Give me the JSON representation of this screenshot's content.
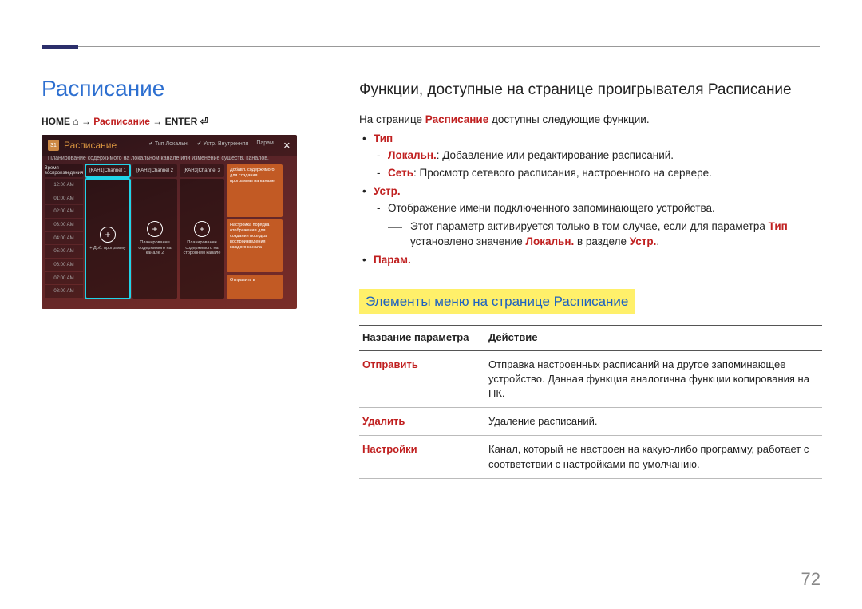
{
  "page_number": "72",
  "left": {
    "title": "Расписание",
    "breadcrumb": {
      "home": "HOME",
      "arrow1": " → ",
      "schedule": "Расписание",
      "arrow2": " → ",
      "enter": "ENTER"
    }
  },
  "screenshot": {
    "cal_icon_text": "31",
    "title": "Расписание",
    "header_right": {
      "type_label": "✔ Тип",
      "type_value": "Локальн.",
      "device_label": "✔ Устр.",
      "device_value": "Внутренняя",
      "options": "Парам.",
      "close": "✕"
    },
    "subtitle": "Планирование содержимого на локальном канале или изменение существ. каналов.",
    "time_header": "Время воспроизведения",
    "times": [
      "12:00 AM",
      "01:00 AM",
      "02:00 AM",
      "03:00 AM",
      "04:00 AM",
      "05:00 AM",
      "06:00 AM",
      "07:00 AM",
      "08:00 AM"
    ],
    "channels": [
      {
        "header": "[КАН1]Channel 1",
        "caption": "+ Доб. программу"
      },
      {
        "header": "[КАН2]Channel 2",
        "caption": "Планирование содержимого на канале 2"
      },
      {
        "header": "[КАН3]Channel 3",
        "caption": "Планирование содержимого на стороннем канале"
      }
    ],
    "side": [
      "Добавл. содержимого для создания программы на канале",
      "Настройка порядка отображения для создания порядка воспроизведения каждого канала",
      "Отправить в"
    ]
  },
  "right": {
    "heading": "Функции, доступные на странице проигрывателя Расписание",
    "intro_a": "На странице ",
    "intro_b": "Расписание",
    "intro_c": " доступны следующие функции.",
    "bullets": {
      "type": "Тип",
      "type_local_name": "Локальн.",
      "type_local_txt": ": Добавление или редактирование расписаний.",
      "type_net_name": "Сеть",
      "type_net_txt": ": Просмотр сетевого расписания, настроенного на сервере.",
      "device": "Устр.",
      "device_txt": "Отображение имени подключенного запоминающего устройства.",
      "device_note_a": "Этот параметр активируется только в том случае, если для параметра ",
      "device_note_b": "Тип",
      "device_note_c": " установлено значение ",
      "device_note_d": "Локальн.",
      "device_note_e": " в разделе ",
      "device_note_f": "Устр.",
      "options": "Парам."
    },
    "section_heading": "Элементы меню на странице Расписание",
    "table": {
      "col1": "Название параметра",
      "col2": "Действие",
      "rows": [
        {
          "name": "Отправить",
          "desc": "Отправка настроенных расписаний на другое запоминающее устройство. Данная функция аналогична функции копирования на ПК."
        },
        {
          "name": "Удалить",
          "desc": "Удаление расписаний."
        },
        {
          "name": "Настройки",
          "desc": "Канал, который не настроен на какую-либо программу, работает с соответствии с настройками по умолчанию."
        }
      ]
    }
  }
}
